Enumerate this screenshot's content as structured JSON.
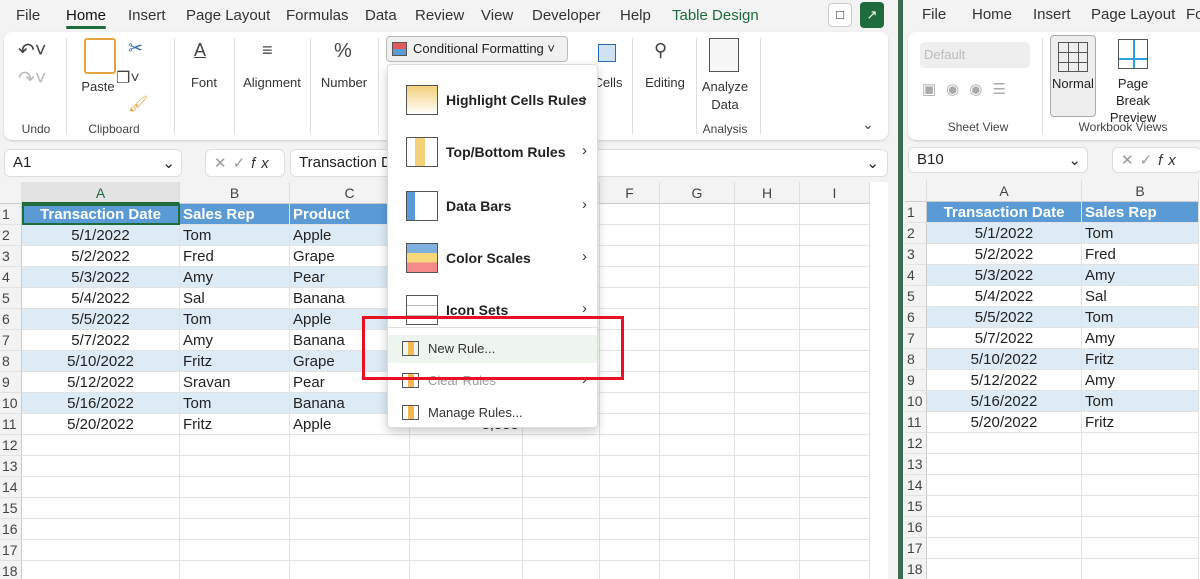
{
  "left": {
    "tabs": [
      "File",
      "Home",
      "Insert",
      "Page Layout",
      "Formulas",
      "Data",
      "Review",
      "View",
      "Developer",
      "Help",
      "Table Design"
    ],
    "active_tab": "Home",
    "ribbon": {
      "undo_group": "Undo",
      "paste": "Paste",
      "clipboard_group": "Clipboard",
      "font": "Font",
      "alignment": "Alignment",
      "number": "Number",
      "conditional_formatting": "Conditional Formatting",
      "cells": "Cells",
      "editing": "Editing",
      "analyze_data": "Analyze Data",
      "analysis_group": "Analysis"
    },
    "name_box": "A1",
    "formula": "Transaction Date",
    "columns": [
      "A",
      "B",
      "C",
      "D",
      "E",
      "F",
      "G",
      "H",
      "I"
    ],
    "headers": [
      "Transaction Date",
      "Sales Rep",
      "Product"
    ],
    "rows": [
      [
        "5/1/2022",
        "Tom",
        "Apple"
      ],
      [
        "5/2/2022",
        "Fred",
        "Grape"
      ],
      [
        "5/3/2022",
        "Amy",
        "Pear"
      ],
      [
        "5/4/2022",
        "Sal",
        "Banana"
      ],
      [
        "5/5/2022",
        "Tom",
        "Apple"
      ],
      [
        "5/7/2022",
        "Amy",
        "Banana"
      ],
      [
        "5/10/2022",
        "Fritz",
        "Grape"
      ],
      [
        "5/12/2022",
        "Sravan",
        "Pear"
      ],
      [
        "5/16/2022",
        "Tom",
        "Banana"
      ],
      [
        "5/20/2022",
        "Fritz",
        "Apple"
      ]
    ],
    "partial_d11": "3,555"
  },
  "menu": {
    "items": [
      {
        "label": "Highlight Cells Rules",
        "icon": "highlight-cells-icon",
        "submenu": true
      },
      {
        "label": "Top/Bottom Rules",
        "icon": "top-bottom-icon",
        "submenu": true
      },
      {
        "label": "Data Bars",
        "icon": "data-bars-icon",
        "submenu": true
      },
      {
        "label": "Color Scales",
        "icon": "color-scales-icon",
        "submenu": true
      },
      {
        "label": "Icon Sets",
        "icon": "icon-sets-icon",
        "submenu": true
      },
      {
        "label": "New Rule...",
        "icon": "new-rule-icon",
        "submenu": false,
        "hovered": true
      },
      {
        "label": "Clear Rules",
        "icon": "clear-rules-icon",
        "submenu": true
      },
      {
        "label": "Manage Rules...",
        "icon": "manage-rules-icon",
        "submenu": false
      }
    ],
    "highlight_color": "#e81123"
  },
  "right": {
    "tabs": [
      "File",
      "Home",
      "Insert",
      "Page Layout",
      "Fo"
    ],
    "sheet_view_select": "Default",
    "sheet_view_group": "Sheet View",
    "normal": "Normal",
    "page_break": "Page Break Preview",
    "workbook_views_group": "Workbook Views",
    "name_box": "B10",
    "columns": [
      "A",
      "B"
    ],
    "headers": [
      "Transaction Date",
      "Sales Rep"
    ],
    "rows": [
      [
        "5/1/2022",
        "Tom"
      ],
      [
        "5/2/2022",
        "Fred"
      ],
      [
        "5/3/2022",
        "Amy"
      ],
      [
        "5/4/2022",
        "Sal"
      ],
      [
        "5/5/2022",
        "Tom"
      ],
      [
        "5/7/2022",
        "Amy"
      ],
      [
        "5/10/2022",
        "Fritz"
      ],
      [
        "5/12/2022",
        "Amy"
      ],
      [
        "5/16/2022",
        "Tom"
      ],
      [
        "5/20/2022",
        "Fritz"
      ]
    ]
  },
  "colors": {
    "accent": "#1e6b3c",
    "table_header": "#5b9bd5",
    "band": "#ddebf7"
  }
}
